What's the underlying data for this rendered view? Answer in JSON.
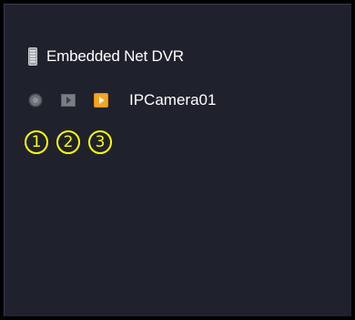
{
  "tree": {
    "device": {
      "icon": "dvr-device-icon",
      "label": "Embedded Net DVR"
    },
    "camera": {
      "label": "IPCamera01",
      "controls": [
        {
          "icon": "record-status-icon",
          "state": "inactive"
        },
        {
          "icon": "play-stream-icon",
          "state": "inactive"
        },
        {
          "icon": "play-stream-active-icon",
          "state": "active"
        }
      ]
    }
  },
  "annotations": [
    "1",
    "2",
    "3"
  ],
  "colors": {
    "panel_bg": "#1f222c",
    "text": "#ffffff",
    "annotation": "#ffff00",
    "active_control": "#f5a623",
    "inactive_control": "#7a7d84"
  }
}
